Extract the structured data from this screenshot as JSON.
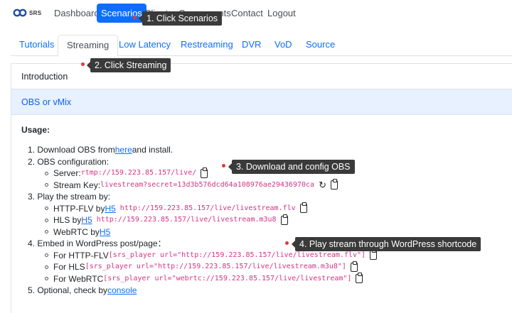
{
  "brand": {
    "text": "SRS",
    "icon": "srs-logo-icon"
  },
  "nav": {
    "items": [
      "Dashboard",
      "Scenarios",
      "Clients",
      "Components",
      "Contact",
      "Logout"
    ],
    "active": "Scenarios"
  },
  "tabs": {
    "items": [
      "Tutorials",
      "Streaming",
      "Low Latency",
      "Restreaming",
      "DVR",
      "VoD",
      "Source"
    ],
    "active": "Streaming"
  },
  "accordion": {
    "intro": "Introduction",
    "obs": "OBS or vMix"
  },
  "usage": {
    "title": "Usage:",
    "step1": {
      "prefix": "1. Download OBS from ",
      "link": "here",
      "suffix": " and install."
    },
    "step2": {
      "title": "2. OBS configuration:",
      "server_label": "Server: ",
      "server_value": "rtmp://159.223.85.157/live/",
      "key_label": "Stream Key: ",
      "key_value": "livestream?secret=13d3b576dcd64a108976ae29436970ca"
    },
    "step3": {
      "title": "3. Play the stream by:",
      "flv_label": "HTTP-FLV by ",
      "flv_link": "H5",
      "flv_url": "http://159.223.85.157/live/livestream.flv",
      "hls_label": "HLS by ",
      "hls_link": "H5",
      "hls_url": "http://159.223.85.157/live/livestream.m3u8",
      "webrtc_label": "WebRTC by ",
      "webrtc_link": "H5"
    },
    "step4": {
      "title": "4. Embed in WordPress post/page：",
      "flv_label": "For HTTP-FLV ",
      "flv_code": "[srs_player url=\"http://159.223.85.157/live/livestream.flv\"]",
      "hls_label": "For HLS ",
      "hls_code": "[srs_player url=\"http://159.223.85.157/live/livestream.m3u8\"]",
      "webrtc_label": "For WebRTC ",
      "webrtc_code": "[srs_player url=\"webrtc://159.223.85.157/live/livestream\"]"
    },
    "step5": {
      "prefix": "5. Optional, check by ",
      "link": "console"
    }
  },
  "annotations": [
    "1. Click Scenarios",
    "2. Click Streaming",
    "3. Download and config OBS",
    "4. Play stream through WordPress shortcode"
  ],
  "colors": {
    "accent": "#0d6efd",
    "code": "#d63384",
    "callout_bg": "#3a3a3a",
    "marker": "#e03a2f"
  }
}
